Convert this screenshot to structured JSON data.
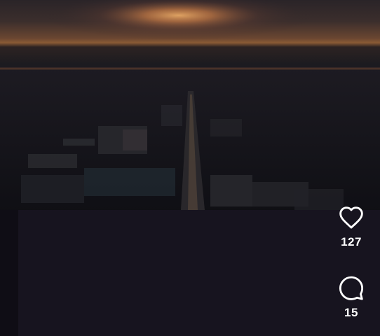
{
  "media": {
    "icon": "aerial-sunset-city-video"
  },
  "actions": {
    "like": {
      "icon": "heart-icon",
      "count": "127"
    },
    "comment": {
      "icon": "comment-bubble-icon",
      "count": "15"
    }
  },
  "colors": {
    "background": "#17141f",
    "icon": "#ffffff",
    "sun": "#d9904f"
  }
}
